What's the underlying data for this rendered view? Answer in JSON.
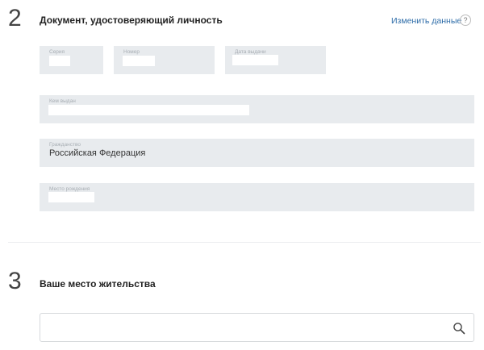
{
  "section2": {
    "number": "2",
    "title": "Документ, удостоверяющий личность",
    "edit_link": "Изменить данные",
    "help_label": "?",
    "fields": {
      "series": {
        "label": "Серия",
        "value": ""
      },
      "number": {
        "label": "Номер",
        "value": ""
      },
      "issue_date": {
        "label": "Дата выдачи",
        "value": ""
      },
      "issued_by": {
        "label": "Кем выдан",
        "value": ""
      },
      "citizenship": {
        "label": "Гражданство",
        "value": "Российская Федерация"
      },
      "birth_place": {
        "label": "Место рождения",
        "value": ""
      }
    }
  },
  "section3": {
    "number": "3",
    "title": "Ваше место жительства",
    "search": {
      "value": "",
      "icon": "search-icon"
    }
  },
  "colors": {
    "field_bg": "#e8ebee",
    "link": "#2d6ca8"
  }
}
